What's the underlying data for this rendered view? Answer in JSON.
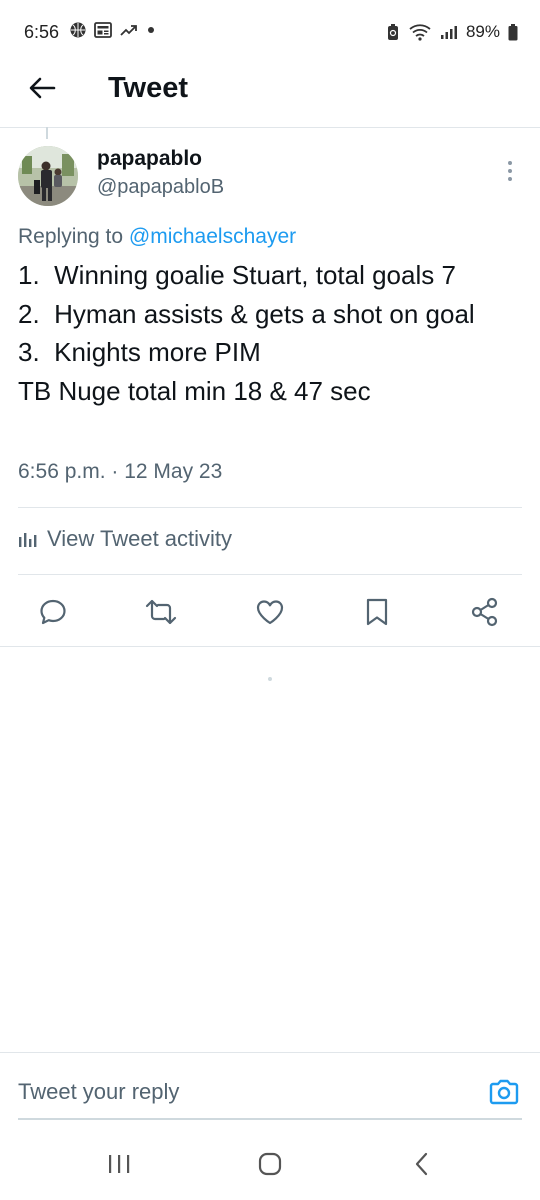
{
  "status_bar": {
    "time": "6:56",
    "battery": "89%"
  },
  "header": {
    "title": "Tweet"
  },
  "tweet": {
    "display_name": "papapablo",
    "handle": "@papapabloB",
    "replying_prefix": "Replying to ",
    "replying_to": "@michaelschayer",
    "lines": [
      "1.  Winning goalie Stuart, total goals 7",
      "2.  Hyman assists & gets a shot on goal",
      "3.  Knights more PIM",
      "TB Nuge total min 18 & 47 sec"
    ],
    "timestamp": "6:56 p.m. · 12 May 23",
    "activity_label": "View Tweet activity"
  },
  "actions": [
    "reply-icon",
    "retweet-icon",
    "like-icon",
    "bookmark-icon",
    "share-icon"
  ],
  "reply": {
    "placeholder": "Tweet your reply"
  },
  "colors": {
    "link": "#1d9bf0",
    "secondary": "#536471",
    "text": "#0f1419",
    "divider": "#e1e6ea"
  }
}
